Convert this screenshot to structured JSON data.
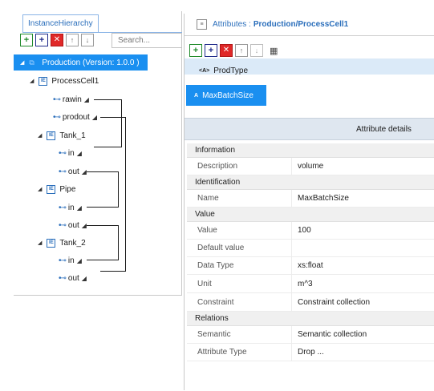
{
  "left": {
    "tab_label": "InstanceHierarchy",
    "search_placeholder": "Search...",
    "tree": {
      "root_label": "Production (Version: 1.0.0 )",
      "processcell": "ProcessCell1",
      "rawin": "rawin",
      "prodout": "prodout",
      "tank1": "Tank_1",
      "tank1_in": "in",
      "tank1_out": "out",
      "pipe": "Pipe",
      "pipe_in": "in",
      "pipe_out": "out",
      "tank2": "Tank_2",
      "tank2_in": "in",
      "tank2_out": "out"
    }
  },
  "right": {
    "header_prefix": "Attributes :",
    "header_path": "Production/ProcessCell1",
    "items": {
      "prodtype": "ProdType",
      "prodtype_badge": "<A>",
      "maxbatch": "MaxBatchSize",
      "maxbatch_badge": "A"
    },
    "details_title": "Attribute details",
    "sections": {
      "information": "Information",
      "identification": "Identification",
      "value": "Value",
      "relations": "Relations"
    },
    "rows": {
      "description": {
        "name": "Description",
        "value": "volume"
      },
      "name": {
        "name": "Name",
        "value": "MaxBatchSize"
      },
      "value": {
        "name": "Value",
        "value": "100"
      },
      "default_value": {
        "name": "Default value",
        "value": ""
      },
      "data_type": {
        "name": "Data Type",
        "value": "xs:float"
      },
      "unit": {
        "name": "Unit",
        "value": "m^3"
      },
      "constraint": {
        "name": "Constraint",
        "value": "Constraint collection"
      },
      "semantic": {
        "name": "Semantic",
        "value": "Semantic collection"
      },
      "attribute_type": {
        "name": "Attribute Type",
        "value": "Drop ..."
      }
    }
  },
  "colors": {
    "selection": "#1a8ff0",
    "accent_blue": "#2a6ebb",
    "add_green": "#1f8a2a",
    "delete_red": "#e02828"
  },
  "icons": {
    "toolbar": [
      "add-icon",
      "add-child-icon",
      "delete-icon",
      "move-up-icon",
      "move-down-icon"
    ],
    "right_extra": "table-view-icon"
  }
}
